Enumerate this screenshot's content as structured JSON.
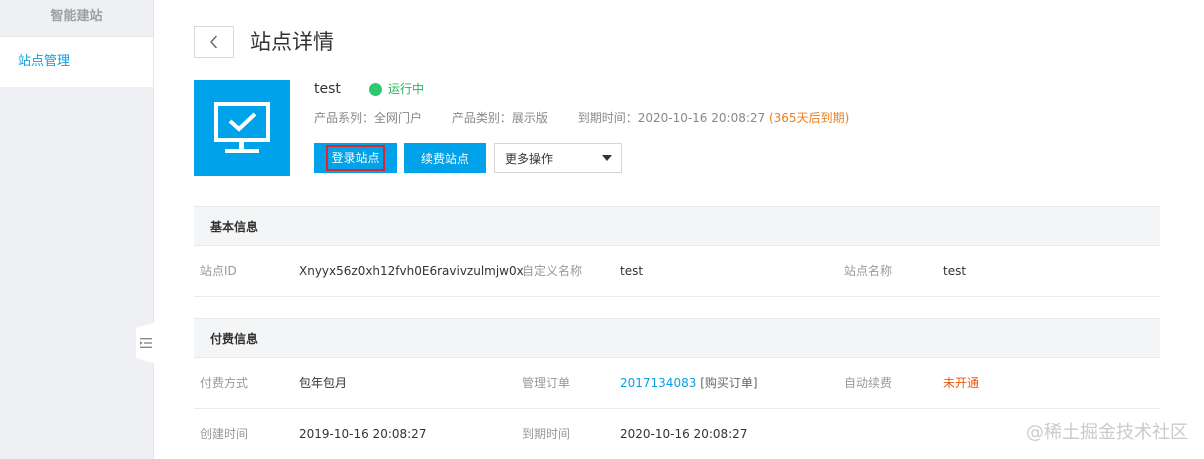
{
  "sidebar": {
    "title": "智能建站",
    "items": [
      {
        "label": "站点管理",
        "active": true
      }
    ]
  },
  "header": {
    "title": "站点详情"
  },
  "site": {
    "name": "test",
    "status": "运行中",
    "product_series": "产品系列：全网门户",
    "product_type": "产品类别：展示版",
    "expire_label": "到期时间：",
    "expire_value": "2020-10-16 20:08:27",
    "expire_warning": "(365天后到期)"
  },
  "actions": {
    "login_label": "登录站点",
    "renew_label": "续费站点",
    "more_label": "更多操作"
  },
  "basic_info": {
    "title": "基本信息",
    "site_id_label": "站点ID",
    "site_id_value": "Xnyyx56z0xh12fvh0E6ravivzulmjw0x",
    "custom_name_label": "自定义名称",
    "custom_name_value": "test",
    "site_name_label": "站点名称",
    "site_name_value": "test"
  },
  "payment_info": {
    "title": "付费信息",
    "pay_method_label": "付费方式",
    "pay_method_value": "包年包月",
    "order_label": "管理订单",
    "order_id": "2017134083",
    "order_link": "[购买订单]",
    "auto_renew_label": "自动续费",
    "auto_renew_value": "未开通",
    "created_label": "创建时间",
    "created_value": "2019-10-16 20:08:27",
    "expire_label": "到期时间",
    "expire_value": "2020-10-16 20:08:27"
  },
  "watermark": "@稀土掘金技术社区",
  "colors": {
    "accent": "#00a2ea",
    "status_green": "#22b561",
    "warning_orange": "#ef7d1a",
    "danger_red": "#e85a0c"
  }
}
